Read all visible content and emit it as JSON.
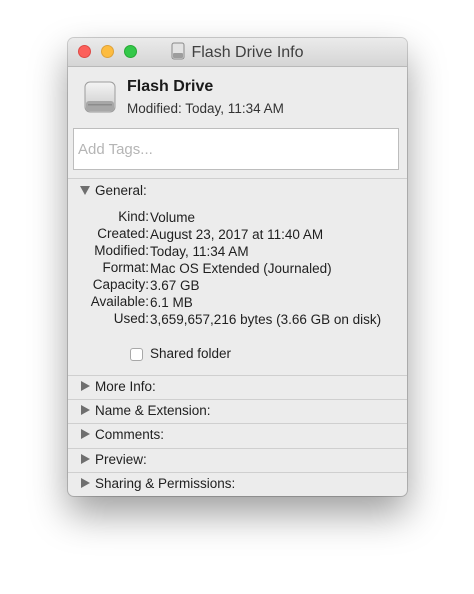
{
  "window": {
    "title": "Flash Drive Info",
    "controls": {
      "close": "close",
      "minimize": "minimize",
      "zoom": "zoom"
    }
  },
  "header": {
    "name": "Flash Drive",
    "modified": "Modified:  Today, 11:34 AM",
    "icon": "drive-icon"
  },
  "tags": {
    "placeholder": "Add Tags..."
  },
  "general": {
    "label": "General:",
    "expanded": true,
    "rows": [
      {
        "key": "Kind:",
        "value": "Volume"
      },
      {
        "key": "Created:",
        "value": "August 23, 2017 at 11:40 AM"
      },
      {
        "key": "Modified:",
        "value": "Today, 11:34 AM"
      },
      {
        "key": "Format:",
        "value": "Mac OS Extended (Journaled)"
      },
      {
        "key": "Capacity:",
        "value": "3.67 GB"
      },
      {
        "key": "Available:",
        "value": "6.1 MB"
      },
      {
        "key": "Used:",
        "value": "3,659,657,216 bytes (3.66 GB on disk)"
      }
    ],
    "shared_folder": {
      "label": "Shared folder",
      "checked": false
    }
  },
  "sections": [
    {
      "label": "More Info:",
      "expanded": false
    },
    {
      "label": "Name & Extension:",
      "expanded": false
    },
    {
      "label": "Comments:",
      "expanded": false
    },
    {
      "label": "Preview:",
      "expanded": false
    },
    {
      "label": "Sharing & Permissions:",
      "expanded": false
    }
  ]
}
